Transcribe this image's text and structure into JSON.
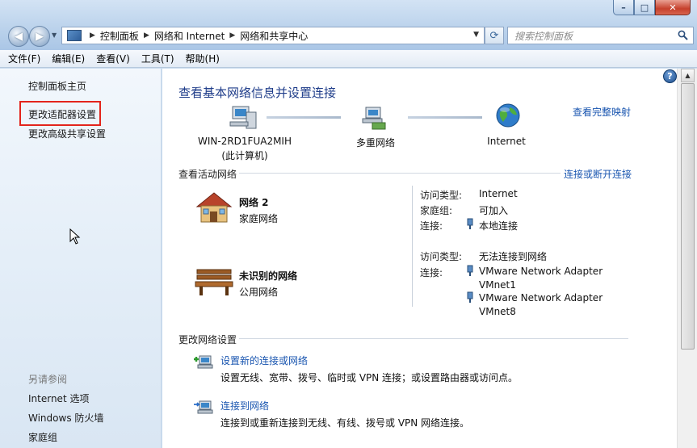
{
  "window": {
    "min": "–",
    "max": "□",
    "close": "✕"
  },
  "address": {
    "crumbs": [
      "控制面板",
      "网络和 Internet",
      "网络和共享中心"
    ],
    "search_placeholder": "搜索控制面板"
  },
  "menu": [
    "文件(F)",
    "编辑(E)",
    "查看(V)",
    "工具(T)",
    "帮助(H)"
  ],
  "left": {
    "links": [
      "控制面板主页",
      "更改适配器设置",
      "更改高级共享设置"
    ],
    "see_also_title": "另请参阅",
    "see_also": [
      "Internet 选项",
      "Windows 防火墙",
      "家庭组"
    ]
  },
  "main": {
    "title": "查看基本网络信息并设置连接",
    "view_full_map": "查看完整映射",
    "map": {
      "computer_name": "WIN-2RD1FUA2MIH",
      "computer_sub": "(此计算机)",
      "middle": "多重网络",
      "internet": "Internet"
    },
    "active_title": "查看活动网络",
    "connect_disconnect": "连接或断开连接",
    "net1": {
      "name": "网络  2",
      "type": "家庭网络",
      "access_label": "访问类型:",
      "access_value": "Internet",
      "homegroup_label": "家庭组:",
      "homegroup_value": "可加入",
      "conn_label": "连接:",
      "conn_value": "本地连接"
    },
    "net2": {
      "name": "未识别的网络",
      "type": "公用网络",
      "access_label": "访问类型:",
      "access_value": "无法连接到网络",
      "conn_label": "连接:",
      "conn1a": "VMware Network Adapter",
      "conn1b": "VMnet1",
      "conn2a": "VMware Network Adapter",
      "conn2b": "VMnet8"
    },
    "change_title": "更改网络设置",
    "tasks": [
      {
        "title": "设置新的连接或网络",
        "desc": "设置无线、宽带、拨号、临时或 VPN 连接；或设置路由器或访问点。"
      },
      {
        "title": "连接到网络",
        "desc": "连接到或重新连接到无线、有线、拨号或 VPN 网络连接。"
      }
    ]
  },
  "help": "?"
}
